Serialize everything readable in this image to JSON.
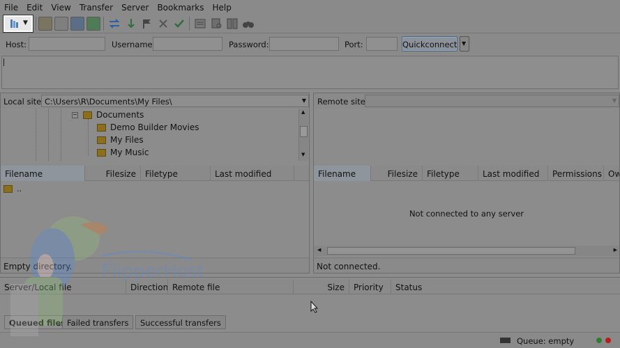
{
  "menu": [
    "File",
    "Edit",
    "View",
    "Transfer",
    "Server",
    "Bookmarks",
    "Help"
  ],
  "quickconnect": {
    "host_label": "Host:",
    "username_label": "Username:",
    "password_label": "Password:",
    "port_label": "Port:",
    "button_label": "Quickconnect"
  },
  "local": {
    "site_label": "Local site:",
    "path": "C:\\Users\\R\\Documents\\My Files\\",
    "tree": [
      "Documents",
      "Demo Builder Movies",
      "My Files",
      "My Music"
    ],
    "columns": [
      "Filename",
      "Filesize",
      "Filetype",
      "Last modified"
    ],
    "rows": [
      ".."
    ],
    "status": "Empty directory."
  },
  "remote": {
    "site_label": "Remote site:",
    "columns": [
      "Filename",
      "Filesize",
      "Filetype",
      "Last modified",
      "Permissions",
      "Ow"
    ],
    "message": "Not connected to any server",
    "status": "Not connected."
  },
  "queue": {
    "columns": [
      "Server/Local file",
      "Direction",
      "Remote file",
      "Size",
      "Priority",
      "Status"
    ],
    "tabs": [
      "Queued files",
      "Failed transfers",
      "Successful transfers"
    ],
    "status": "Queue: empty"
  },
  "watermark": "FlipperHost",
  "colors": {
    "accent": "#2f5fa0",
    "led_green": "#2e7d32",
    "led_red": "#b71c1c"
  }
}
